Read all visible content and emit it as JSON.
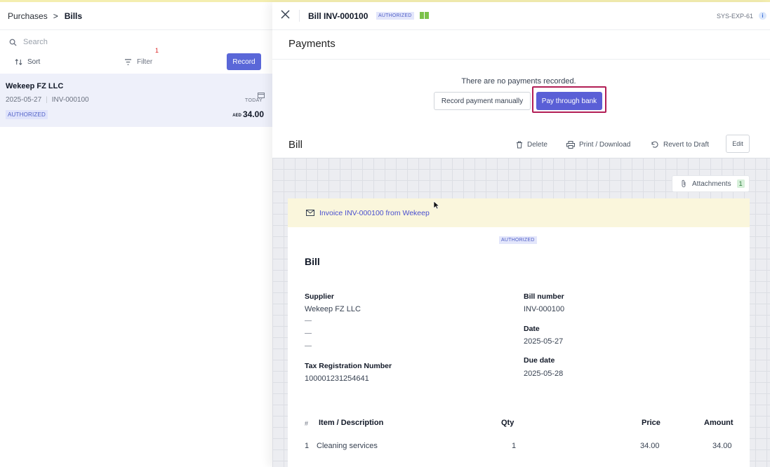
{
  "breadcrumb": {
    "parent": "Purchases",
    "separator": ">",
    "current": "Bills"
  },
  "list_toolbar": {
    "search_placeholder": "Search",
    "sort_label": "Sort",
    "filter_label": "Filter",
    "filter_count": "1",
    "record_label": "Record"
  },
  "bill_list": [
    {
      "supplier": "Wekeep FZ LLC",
      "date": "2025-05-27",
      "separator": "|",
      "number": "INV-000100",
      "due_label": "TODAY",
      "status": "AUTHORIZED",
      "currency": "AED",
      "amount": "34.00"
    }
  ],
  "detail_header": {
    "title": "Bill INV-000100",
    "status": "AUTHORIZED",
    "system_id": "SYS-EXP-61",
    "info": "i"
  },
  "payments": {
    "title": "Payments",
    "empty_text": "There are no payments recorded.",
    "record_manual_label": "Record payment manually",
    "pay_bank_label": "Pay through bank"
  },
  "bill_actions": {
    "title": "Bill",
    "delete_label": "Delete",
    "print_label": "Print / Download",
    "revert_label": "Revert to Draft",
    "edit_label": "Edit"
  },
  "attachments": {
    "label": "Attachments",
    "count": "1"
  },
  "document": {
    "banner_text": "Invoice INV-000100 from Wekeep",
    "status": "AUTHORIZED",
    "title": "Bill",
    "supplier_label": "Supplier",
    "supplier_name": "Wekeep FZ LLC",
    "supplier_lines": [
      "—",
      "—",
      "—"
    ],
    "trn_label": "Tax Registration Number",
    "trn_value": "100001231254641",
    "bill_number_label": "Bill number",
    "bill_number": "INV-000100",
    "date_label": "Date",
    "date": "2025-05-27",
    "due_date_label": "Due date",
    "due_date": "2025-05-28",
    "table": {
      "headers": {
        "index": "#",
        "item": "Item / Description",
        "qty": "Qty",
        "price": "Price",
        "amount": "Amount"
      },
      "rows": [
        {
          "index": "1",
          "item": "Cleaning services",
          "qty": "1",
          "price": "34.00",
          "amount": "34.00"
        }
      ]
    }
  },
  "colors": {
    "accent": "#5a5fd6",
    "highlight": "#b21e55",
    "banner": "#faf6dc"
  }
}
